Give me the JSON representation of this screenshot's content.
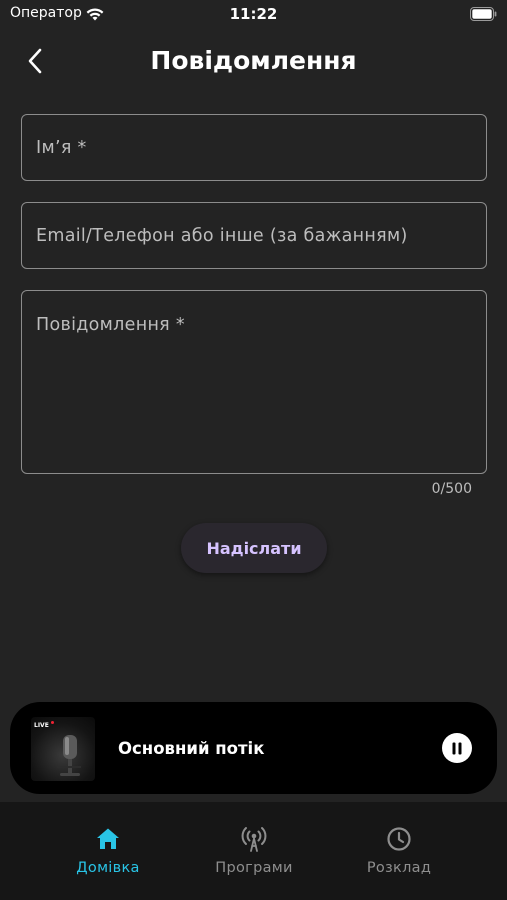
{
  "status_bar": {
    "carrier": "Оператор",
    "time": "11:22"
  },
  "header": {
    "title": "Повідомлення"
  },
  "form": {
    "name_placeholder": "Ім’я *",
    "contact_placeholder": "Email/Телефон або інше (за бажанням)",
    "message_placeholder": "Повідомлення *",
    "counter": "0/500",
    "send_label": "Надіслати"
  },
  "player": {
    "live_label": "LIVE",
    "title": "Основний потік",
    "state": "playing"
  },
  "tabs": [
    {
      "label": "Домівка",
      "icon": "home-icon",
      "active": true
    },
    {
      "label": "Програми",
      "icon": "broadcast-icon",
      "active": false
    },
    {
      "label": "Розклад",
      "icon": "clock-icon",
      "active": false
    }
  ],
  "colors": {
    "background": "#232323",
    "accent": "#29c4e6",
    "button_text": "#d6c3ff",
    "tab_bar": "#161616"
  }
}
